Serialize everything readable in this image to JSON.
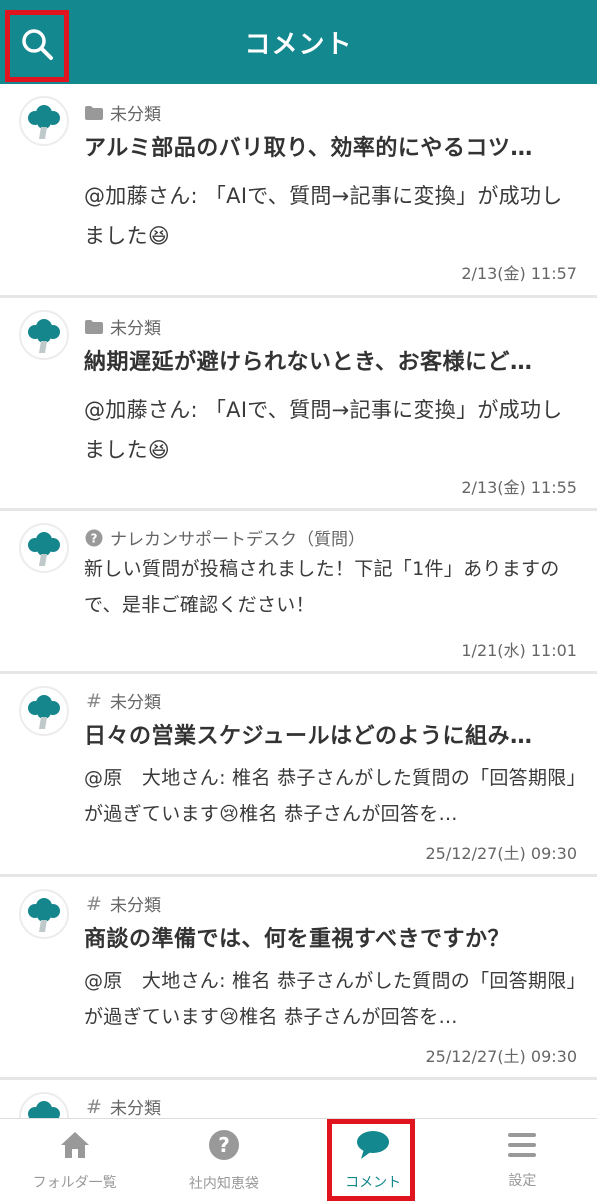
{
  "header": {
    "title": "コメント",
    "search_icon": "search-icon"
  },
  "colors": {
    "primary": "#13888f",
    "highlight": "#e0141e"
  },
  "comments": [
    {
      "category_icon": "folder-icon",
      "category": "未分類",
      "title": "アルミ部品のバリ取り、効率的にやるコツ…",
      "body": "@加藤さん: 「AIで、質問→記事に変換」が成功しました😆",
      "date": "2/13(金) 11:57"
    },
    {
      "category_icon": "folder-icon",
      "category": "未分類",
      "title": "納期遅延が避けられないとき、お客様にど…",
      "body": "@加藤さん: 「AIで、質問→記事に変換」が成功しました😆",
      "date": "2/13(金) 11:55"
    },
    {
      "category_icon": "question-circle-icon",
      "category": "ナレカンサポートデスク（質問）",
      "title": "",
      "body": "新しい質問が投稿されました！下記「1件」ありますので、是非ご確認ください！",
      "date": "1/21(水) 11:01"
    },
    {
      "category_icon": "hash-icon",
      "category": "未分類",
      "title": "日々の営業スケジュールはどのように組み…",
      "body": "@原　大地さん: 椎名 恭子さんがした質問の「回答期限」が過ぎています😢椎名 恭子さんが回答を…",
      "date": "25/12/27(土) 09:30"
    },
    {
      "category_icon": "hash-icon",
      "category": "未分類",
      "title": "商談の準備では、何を重視すべきですか？",
      "body": "@原　大地さん: 椎名 恭子さんがした質問の「回答期限」が過ぎています😢椎名 恭子さんが回答を…",
      "date": "25/12/27(土) 09:30"
    },
    {
      "category_icon": "hash-icon",
      "category": "未分類",
      "title": "",
      "body": "",
      "date": ""
    }
  ],
  "tabs": [
    {
      "label": "フォルダ一覧",
      "icon": "home-icon"
    },
    {
      "label": "社内知恵袋",
      "icon": "question-icon"
    },
    {
      "label": "コメント",
      "icon": "chat-bubble-icon"
    },
    {
      "label": "設定",
      "icon": "menu-icon"
    }
  ]
}
